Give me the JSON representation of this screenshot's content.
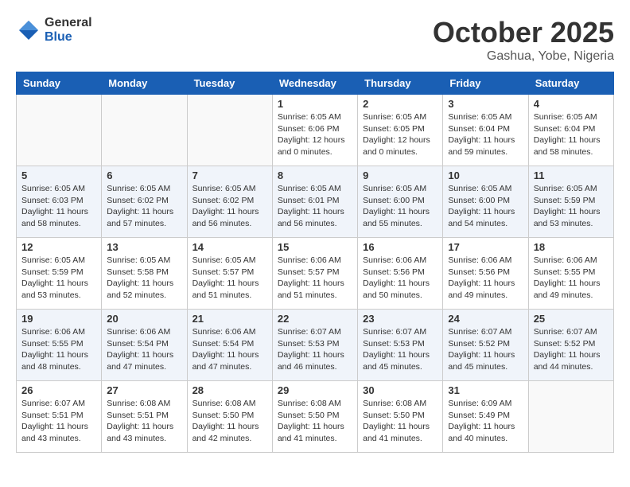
{
  "header": {
    "logo_general": "General",
    "logo_blue": "Blue",
    "month": "October 2025",
    "location": "Gashua, Yobe, Nigeria"
  },
  "days_of_week": [
    "Sunday",
    "Monday",
    "Tuesday",
    "Wednesday",
    "Thursday",
    "Friday",
    "Saturday"
  ],
  "weeks": [
    [
      {
        "day": "",
        "sunrise": "",
        "sunset": "",
        "daylight": ""
      },
      {
        "day": "",
        "sunrise": "",
        "sunset": "",
        "daylight": ""
      },
      {
        "day": "",
        "sunrise": "",
        "sunset": "",
        "daylight": ""
      },
      {
        "day": "1",
        "sunrise": "6:05 AM",
        "sunset": "6:06 PM",
        "daylight": "12 hours and 0 minutes."
      },
      {
        "day": "2",
        "sunrise": "6:05 AM",
        "sunset": "6:05 PM",
        "daylight": "12 hours and 0 minutes."
      },
      {
        "day": "3",
        "sunrise": "6:05 AM",
        "sunset": "6:04 PM",
        "daylight": "11 hours and 59 minutes."
      },
      {
        "day": "4",
        "sunrise": "6:05 AM",
        "sunset": "6:04 PM",
        "daylight": "11 hours and 58 minutes."
      }
    ],
    [
      {
        "day": "5",
        "sunrise": "6:05 AM",
        "sunset": "6:03 PM",
        "daylight": "11 hours and 58 minutes."
      },
      {
        "day": "6",
        "sunrise": "6:05 AM",
        "sunset": "6:02 PM",
        "daylight": "11 hours and 57 minutes."
      },
      {
        "day": "7",
        "sunrise": "6:05 AM",
        "sunset": "6:02 PM",
        "daylight": "11 hours and 56 minutes."
      },
      {
        "day": "8",
        "sunrise": "6:05 AM",
        "sunset": "6:01 PM",
        "daylight": "11 hours and 56 minutes."
      },
      {
        "day": "9",
        "sunrise": "6:05 AM",
        "sunset": "6:00 PM",
        "daylight": "11 hours and 55 minutes."
      },
      {
        "day": "10",
        "sunrise": "6:05 AM",
        "sunset": "6:00 PM",
        "daylight": "11 hours and 54 minutes."
      },
      {
        "day": "11",
        "sunrise": "6:05 AM",
        "sunset": "5:59 PM",
        "daylight": "11 hours and 53 minutes."
      }
    ],
    [
      {
        "day": "12",
        "sunrise": "6:05 AM",
        "sunset": "5:59 PM",
        "daylight": "11 hours and 53 minutes."
      },
      {
        "day": "13",
        "sunrise": "6:05 AM",
        "sunset": "5:58 PM",
        "daylight": "11 hours and 52 minutes."
      },
      {
        "day": "14",
        "sunrise": "6:05 AM",
        "sunset": "5:57 PM",
        "daylight": "11 hours and 51 minutes."
      },
      {
        "day": "15",
        "sunrise": "6:06 AM",
        "sunset": "5:57 PM",
        "daylight": "11 hours and 51 minutes."
      },
      {
        "day": "16",
        "sunrise": "6:06 AM",
        "sunset": "5:56 PM",
        "daylight": "11 hours and 50 minutes."
      },
      {
        "day": "17",
        "sunrise": "6:06 AM",
        "sunset": "5:56 PM",
        "daylight": "11 hours and 49 minutes."
      },
      {
        "day": "18",
        "sunrise": "6:06 AM",
        "sunset": "5:55 PM",
        "daylight": "11 hours and 49 minutes."
      }
    ],
    [
      {
        "day": "19",
        "sunrise": "6:06 AM",
        "sunset": "5:55 PM",
        "daylight": "11 hours and 48 minutes."
      },
      {
        "day": "20",
        "sunrise": "6:06 AM",
        "sunset": "5:54 PM",
        "daylight": "11 hours and 47 minutes."
      },
      {
        "day": "21",
        "sunrise": "6:06 AM",
        "sunset": "5:54 PM",
        "daylight": "11 hours and 47 minutes."
      },
      {
        "day": "22",
        "sunrise": "6:07 AM",
        "sunset": "5:53 PM",
        "daylight": "11 hours and 46 minutes."
      },
      {
        "day": "23",
        "sunrise": "6:07 AM",
        "sunset": "5:53 PM",
        "daylight": "11 hours and 45 minutes."
      },
      {
        "day": "24",
        "sunrise": "6:07 AM",
        "sunset": "5:52 PM",
        "daylight": "11 hours and 45 minutes."
      },
      {
        "day": "25",
        "sunrise": "6:07 AM",
        "sunset": "5:52 PM",
        "daylight": "11 hours and 44 minutes."
      }
    ],
    [
      {
        "day": "26",
        "sunrise": "6:07 AM",
        "sunset": "5:51 PM",
        "daylight": "11 hours and 43 minutes."
      },
      {
        "day": "27",
        "sunrise": "6:08 AM",
        "sunset": "5:51 PM",
        "daylight": "11 hours and 43 minutes."
      },
      {
        "day": "28",
        "sunrise": "6:08 AM",
        "sunset": "5:50 PM",
        "daylight": "11 hours and 42 minutes."
      },
      {
        "day": "29",
        "sunrise": "6:08 AM",
        "sunset": "5:50 PM",
        "daylight": "11 hours and 41 minutes."
      },
      {
        "day": "30",
        "sunrise": "6:08 AM",
        "sunset": "5:50 PM",
        "daylight": "11 hours and 41 minutes."
      },
      {
        "day": "31",
        "sunrise": "6:09 AM",
        "sunset": "5:49 PM",
        "daylight": "11 hours and 40 minutes."
      },
      {
        "day": "",
        "sunrise": "",
        "sunset": "",
        "daylight": ""
      }
    ]
  ]
}
